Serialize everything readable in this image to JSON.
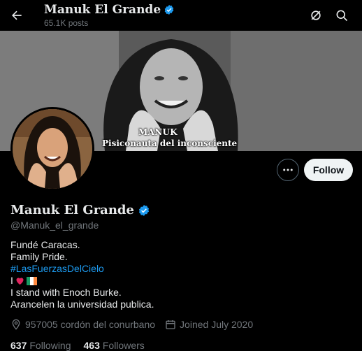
{
  "header": {
    "name": "Manuk El Grande",
    "posts": "65.1K posts"
  },
  "banner": {
    "caption_line1": "MANUK",
    "caption_line2": "Pisiconauta del inconsciente"
  },
  "actions": {
    "follow_label": "Follow"
  },
  "profile": {
    "name": "Manuk El Grande",
    "handle": "@Manuk_el_grande",
    "bio": {
      "line1": "Fundé Caracas.",
      "line2": "Family Pride.",
      "hashtag": "#LasFuerzasDelCielo",
      "line4_prefix": "I",
      "line5": "I stand with Enoch Burke.",
      "line6": "Arancelen la universidad publica."
    },
    "location": "957005 cordón del conurbano",
    "joined": "Joined July 2020",
    "following_count": "637",
    "following_label": "Following",
    "followers_count": "463",
    "followers_label": "Followers"
  },
  "colors": {
    "accent": "#1d9bf0",
    "background": "#000000",
    "verified": "#1d9bf0",
    "heart": "#e0245e"
  },
  "icons": [
    "back-arrow-icon",
    "verified-icon",
    "grok-icon",
    "search-icon",
    "more-icon",
    "location-icon",
    "calendar-icon",
    "heart-icon",
    "irish-flag-icon"
  ]
}
